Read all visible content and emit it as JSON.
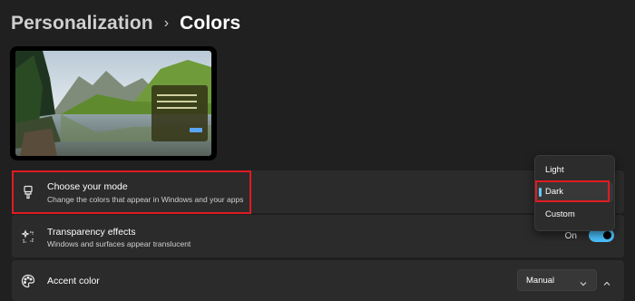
{
  "breadcrumb": {
    "parent": "Personalization",
    "separator": "›",
    "current": "Colors"
  },
  "preview": {
    "description_icon": "landscape-preview"
  },
  "rows": {
    "mode": {
      "title": "Choose your mode",
      "description": "Change the colors that appear in Windows and your apps",
      "icon": "brush-icon"
    },
    "transparency": {
      "title": "Transparency effects",
      "description": "Windows and surfaces appear translucent",
      "toggle_label": "On",
      "toggle_on": true,
      "icon": "sparkle-icon"
    },
    "accent": {
      "title": "Accent color",
      "select_value": "Manual",
      "icon": "palette-icon"
    }
  },
  "mode_menu": {
    "items": [
      "Light",
      "Dark",
      "Custom"
    ],
    "selected": "Dark"
  },
  "colors": {
    "background": "#202020",
    "card": "#2b2b2b",
    "accent": "#4cc2ff",
    "highlight": "#e01b22"
  }
}
